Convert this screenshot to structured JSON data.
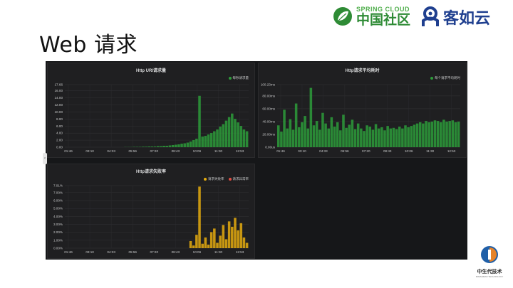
{
  "slide": {
    "title": "Web 请求"
  },
  "brands": {
    "springcloud": {
      "en": "SPRING CLOUD",
      "cn": "中国社区",
      "icon": "springcloud-leaf-icon",
      "color": "#2e8b35"
    },
    "kry": {
      "cn": "客如云",
      "icon": "kry-logo-icon",
      "color": "#1f3f8f"
    }
  },
  "footer": {
    "name": "中生代技术",
    "sub": "FRESHMAN TECHNOLOGY",
    "icon": "zsd-logo-icon"
  },
  "colors": {
    "green": "#2d9c3a",
    "orange": "#e5ac0e",
    "red": "#e24d42",
    "panel_bg": "#1f1f21"
  },
  "charts": [
    {
      "title": "Http URI请求量",
      "legend": [
        {
          "label": "每秒请求量",
          "color": "#2d9c3a"
        }
      ],
      "y_ticks": [
        "0.00",
        "2.00",
        "4.00",
        "6.00",
        "8.00",
        "10.00",
        "12.00",
        "14.00",
        "16.00",
        "17.66"
      ],
      "x_ticks": [
        "01:46",
        "03:10",
        "04:33",
        "05:56",
        "07:20",
        "08:43",
        "10:06",
        "11:30",
        "12:53"
      ]
    },
    {
      "title": "Http请求平均耗时",
      "legend": [
        {
          "label": "每个请求平均耗时",
          "color": "#2d9c3a"
        }
      ],
      "y_ticks": [
        "0.00us",
        "20.00ms",
        "40.00ms",
        "60.00ms",
        "80.00ms",
        "100.23ms"
      ],
      "x_ticks": [
        "01:46",
        "03:10",
        "04:33",
        "05:56",
        "07:20",
        "08:43",
        "10:06",
        "11:30",
        "12:53"
      ]
    },
    {
      "title": "Http请求失败率",
      "legend": [
        {
          "label": "请求失败率",
          "color": "#e5ac0e"
        },
        {
          "label": "请求异常率",
          "color": "#e24d42"
        }
      ],
      "y_ticks": [
        "0.00%",
        "1.00%",
        "2.00%",
        "3.00%",
        "4.00%",
        "5.00%",
        "6.00%",
        "7.00%",
        "7.01%"
      ],
      "x_ticks": [
        "01:46",
        "03:10",
        "04:33",
        "05:56",
        "07:20",
        "08:43",
        "10:06",
        "11:30",
        "12:53"
      ]
    }
  ],
  "chart_data": [
    {
      "type": "area",
      "title": "Http URI请求量",
      "series": [
        {
          "name": "每秒请求量",
          "color": "#2d9c3a",
          "values": [
            0,
            0,
            0,
            0,
            0,
            0,
            0,
            0,
            0,
            0,
            0,
            0,
            0,
            0,
            0,
            0,
            0,
            0,
            0,
            0,
            0.05,
            0.05,
            0.05,
            0.1,
            0.1,
            0.1,
            0.15,
            0.15,
            0.2,
            0.2,
            0.2,
            0.3,
            0.3,
            0.4,
            0.4,
            0.5,
            0.6,
            0.7,
            0.8,
            1.0,
            1.1,
            1.3,
            1.6,
            2.0,
            2.4,
            14.5,
            3.0,
            3.2,
            3.6,
            4.0,
            4.5,
            5.0,
            5.8,
            6.5,
            7.5,
            8.5,
            9.5,
            8.0,
            7.0,
            6.0,
            5.0,
            4.5
          ]
        }
      ],
      "x_labels": [
        "01:46",
        "03:10",
        "04:33",
        "05:56",
        "07:20",
        "08:43",
        "10:06",
        "11:30",
        "12:53"
      ],
      "ylim": [
        0,
        17.66
      ]
    },
    {
      "type": "area",
      "title": "Http请求平均耗时",
      "series": [
        {
          "name": "每个请求平均耗时",
          "color": "#2d9c3a",
          "unit": "ms",
          "values": [
            35,
            25,
            60,
            30,
            45,
            28,
            70,
            32,
            40,
            50,
            30,
            95,
            35,
            42,
            28,
            55,
            38,
            30,
            48,
            33,
            40,
            27,
            52,
            31,
            36,
            44,
            29,
            38,
            30,
            26,
            35,
            33,
            28,
            37,
            30,
            32,
            27,
            34,
            30,
            31,
            29,
            33,
            30,
            35,
            32,
            34,
            36,
            38,
            40,
            38,
            42,
            40,
            41,
            43,
            42,
            40,
            44,
            41,
            42,
            43,
            40,
            41
          ]
        }
      ],
      "x_labels": [
        "01:46",
        "03:10",
        "04:33",
        "05:56",
        "07:20",
        "08:43",
        "10:06",
        "11:30",
        "12:53"
      ],
      "ylim": [
        0,
        100.23
      ]
    },
    {
      "type": "area",
      "title": "Http请求失败率",
      "series": [
        {
          "name": "请求失败率",
          "color": "#e5ac0e",
          "unit": "%",
          "values": [
            0,
            0,
            0,
            0,
            0,
            0,
            0,
            0,
            0,
            0,
            0,
            0,
            0,
            0,
            0,
            0,
            0,
            0,
            0,
            0,
            0,
            0,
            0,
            0,
            0,
            0,
            0,
            0,
            0,
            0,
            0,
            0,
            0,
            0,
            0,
            0,
            0,
            0,
            0,
            0,
            0,
            0,
            0.8,
            0.3,
            1.5,
            6.9,
            0.5,
            1.2,
            0.4,
            1.8,
            2.2,
            0.6,
            1.4,
            2.6,
            1.0,
            3.0,
            2.4,
            3.4,
            2.0,
            2.8,
            1.2,
            0.6
          ]
        },
        {
          "name": "请求异常率",
          "color": "#e24d42",
          "unit": "%",
          "values": []
        }
      ],
      "x_labels": [
        "01:46",
        "03:10",
        "04:33",
        "05:56",
        "07:20",
        "08:43",
        "10:06",
        "11:30",
        "12:53"
      ],
      "ylim": [
        0,
        7.01
      ]
    }
  ]
}
